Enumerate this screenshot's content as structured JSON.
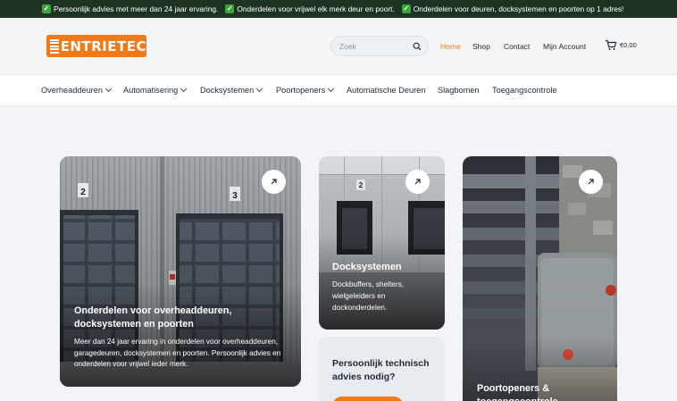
{
  "topbar": {
    "usps": [
      "Persoonlijk advies met meer dan 24 jaar ervaring.",
      "Onderdelen voor vrijwel elk merk deur en poort.",
      "Onderdelen voor deuren, docksystemen en poorten op 1 adres!"
    ]
  },
  "header": {
    "logo_text": "ENTRIETEC",
    "search": {
      "placeholder": "Zoek",
      "value": ""
    },
    "menu": [
      {
        "label": "Home",
        "active": true
      },
      {
        "label": "Shop",
        "active": false
      },
      {
        "label": "Contact",
        "active": false
      },
      {
        "label": "Mijn Account",
        "active": false
      }
    ],
    "cart_total": "€0.00"
  },
  "categories": [
    {
      "label": "Overheaddeuren",
      "dropdown": true
    },
    {
      "label": "Automatisering",
      "dropdown": true
    },
    {
      "label": "Docksystemen",
      "dropdown": true
    },
    {
      "label": "Poortopeners",
      "dropdown": true
    },
    {
      "label": "Automatische Deuren",
      "dropdown": false
    },
    {
      "label": "Slagbomen",
      "dropdown": false
    },
    {
      "label": "Toegangscontrole",
      "dropdown": false
    }
  ],
  "cards": {
    "main": {
      "title": "Onderdelen voor overheaddeuren, docksystemen en poorten",
      "text": "Meer dan 24 jaar ervaring in onderdelen voor overheaddeuren, garagedeuren, docksystemen en poorten. Persoonlijk advies en onderdelen voor vrijwel ieder merk.",
      "door_numbers": [
        "2",
        "3"
      ]
    },
    "dock": {
      "title": "Docksystemen",
      "text": "Dockbuffers, shelters, wielgeleiders en dockonderdelen.",
      "door_number": "2"
    },
    "advice": {
      "title": "Persoonlijk technisch advies nodig?"
    },
    "gate": {
      "title": "Poortopeners & toegangscontrole"
    }
  },
  "colors": {
    "accent": "#ef7a1a",
    "topbar": "#1f3325",
    "check": "#3aa63a"
  }
}
